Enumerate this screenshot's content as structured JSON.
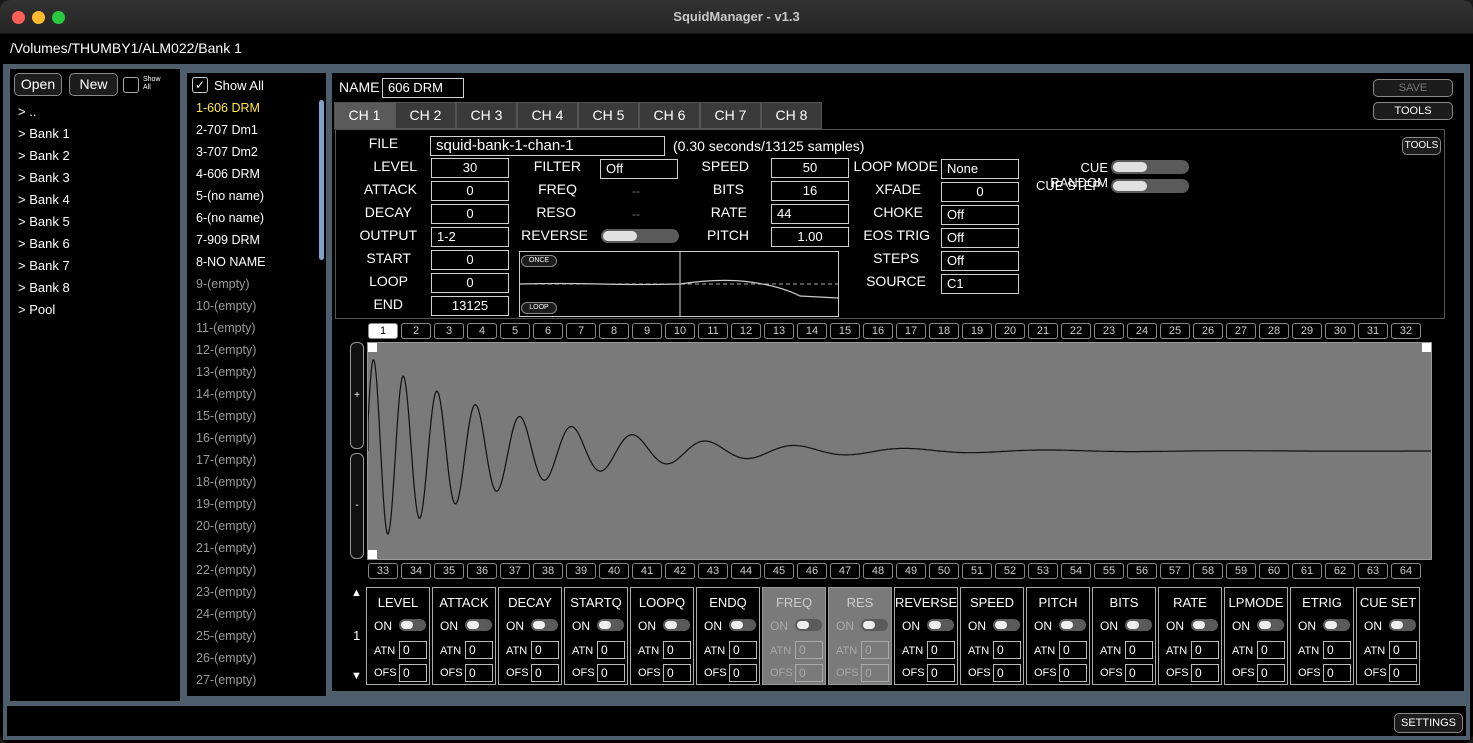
{
  "window": {
    "title": "SquidManager - v1.3",
    "path": "/Volumes/THUMBY1/ALM022/Bank 1"
  },
  "browser": {
    "open_label": "Open",
    "new_label": "New",
    "show_all_label": "Show All",
    "items": [
      "> ..",
      "> Bank 1",
      "> Bank 2",
      "> Bank 3",
      "> Bank 4",
      "> Bank 5",
      "> Bank 6",
      "> Bank 7",
      "> Bank 8",
      "> Pool"
    ]
  },
  "samples": {
    "show_all_label": "Show All",
    "items": [
      "1-606 DRM",
      "2-707 Dm1",
      "3-707 Dm2",
      "4-606 DRM",
      "5-(no name)",
      "6-(no name)",
      "7-909 DRM",
      "8-NO NAME",
      "9-(empty)",
      "10-(empty)",
      "11-(empty)",
      "12-(empty)",
      "13-(empty)",
      "14-(empty)",
      "15-(empty)",
      "16-(empty)",
      "17-(empty)",
      "18-(empty)",
      "19-(empty)",
      "20-(empty)",
      "21-(empty)",
      "22-(empty)",
      "23-(empty)",
      "24-(empty)",
      "25-(empty)",
      "26-(empty)",
      "27-(empty)"
    ],
    "selected": 0
  },
  "editor": {
    "name_label": "NAME",
    "name_value": "606 DRM",
    "save_label": "SAVE",
    "tools_label": "TOOLS",
    "inner_tools_label": "TOOLS",
    "settings_label": "SETTINGS",
    "channels": [
      "CH 1",
      "CH 2",
      "CH 3",
      "CH 4",
      "CH 5",
      "CH 6",
      "CH 7",
      "CH 8"
    ],
    "active_channel": 0,
    "file_label": "FILE",
    "file_value": "squid-bank-1-chan-1",
    "file_info": "(0.30 seconds/13125 samples)",
    "params": {
      "level": {
        "label": "LEVEL",
        "value": "30"
      },
      "attack": {
        "label": "ATTACK",
        "value": "0"
      },
      "decay": {
        "label": "DECAY",
        "value": "0"
      },
      "output": {
        "label": "OUTPUT",
        "value": "1-2"
      },
      "start": {
        "label": "START",
        "value": "0"
      },
      "loop": {
        "label": "LOOP",
        "value": "0"
      },
      "end": {
        "label": "END",
        "value": "13125"
      },
      "filter": {
        "label": "FILTER",
        "value": "Off"
      },
      "freq": {
        "label": "FREQ",
        "value": "--"
      },
      "reso": {
        "label": "RESO",
        "value": "--"
      },
      "reverse": {
        "label": "REVERSE"
      },
      "speed": {
        "label": "SPEED",
        "value": "50"
      },
      "bits": {
        "label": "BITS",
        "value": "16"
      },
      "rate": {
        "label": "RATE",
        "value": "44"
      },
      "pitch": {
        "label": "PITCH",
        "value": "1.00"
      },
      "loop_mode": {
        "label": "LOOP MODE",
        "value": "None"
      },
      "xfade": {
        "label": "XFADE",
        "value": "0"
      },
      "choke": {
        "label": "CHOKE",
        "value": "Off"
      },
      "eos_trig": {
        "label": "EOS TRIG",
        "value": "Off"
      },
      "steps": {
        "label": "STEPS",
        "value": "Off"
      },
      "source": {
        "label": "SOURCE",
        "value": "C1"
      },
      "cue_random": {
        "label": "CUE RANDOM"
      },
      "cue_step": {
        "label": "CUE STEP"
      }
    },
    "envelope": {
      "once_label": "ONCE",
      "loop_label": "LOOP"
    },
    "steps_top": [
      "1",
      "2",
      "3",
      "4",
      "5",
      "6",
      "7",
      "8",
      "9",
      "10",
      "11",
      "12",
      "13",
      "14",
      "15",
      "16",
      "17",
      "18",
      "19",
      "20",
      "21",
      "22",
      "23",
      "24",
      "25",
      "26",
      "27",
      "28",
      "29",
      "30",
      "31",
      "32"
    ],
    "steps_bottom": [
      "33",
      "34",
      "35",
      "36",
      "37",
      "38",
      "39",
      "40",
      "41",
      "42",
      "43",
      "44",
      "45",
      "46",
      "47",
      "48",
      "49",
      "50",
      "51",
      "52",
      "53",
      "54",
      "55",
      "56",
      "57",
      "58",
      "59",
      "60",
      "61",
      "62",
      "63",
      "64"
    ],
    "selected_step": 0,
    "zoom_in": "+",
    "zoom_out": "-"
  },
  "mod": {
    "index": "1",
    "up_arrow": "▲",
    "down_arrow": "▼",
    "on_label": "ON",
    "atn_label": "ATN",
    "ofs_label": "OFS",
    "slots": [
      {
        "name": "LEVEL",
        "atn": "0",
        "ofs": "0",
        "disabled": false
      },
      {
        "name": "ATTACK",
        "atn": "0",
        "ofs": "0",
        "disabled": false
      },
      {
        "name": "DECAY",
        "atn": "0",
        "ofs": "0",
        "disabled": false
      },
      {
        "name": "STARTQ",
        "atn": "0",
        "ofs": "0",
        "disabled": false
      },
      {
        "name": "LOOPQ",
        "atn": "0",
        "ofs": "0",
        "disabled": false
      },
      {
        "name": "ENDQ",
        "atn": "0",
        "ofs": "0",
        "disabled": false
      },
      {
        "name": "FREQ",
        "atn": "0",
        "ofs": "0",
        "disabled": true
      },
      {
        "name": "RES",
        "atn": "0",
        "ofs": "0",
        "disabled": true
      },
      {
        "name": "REVERSE",
        "atn": "0",
        "ofs": "0",
        "disabled": false
      },
      {
        "name": "SPEED",
        "atn": "0",
        "ofs": "0",
        "disabled": false
      },
      {
        "name": "PITCH",
        "atn": "0",
        "ofs": "0",
        "disabled": false
      },
      {
        "name": "BITS",
        "atn": "0",
        "ofs": "0",
        "disabled": false
      },
      {
        "name": "RATE",
        "atn": "0",
        "ofs": "0",
        "disabled": false
      },
      {
        "name": "LPMODE",
        "atn": "0",
        "ofs": "0",
        "disabled": false
      },
      {
        "name": "ETRIG",
        "atn": "0",
        "ofs": "0",
        "disabled": false
      },
      {
        "name": "CUE SET",
        "atn": "0",
        "ofs": "0",
        "disabled": false
      }
    ]
  },
  "colors": {
    "frame": "#4f5e6c",
    "selected_sample": "#ffe94a",
    "empty_sample": "#9a9a9a",
    "waveform_bg": "#7a7a7a",
    "scroll_accent": "#7fa3c8"
  }
}
